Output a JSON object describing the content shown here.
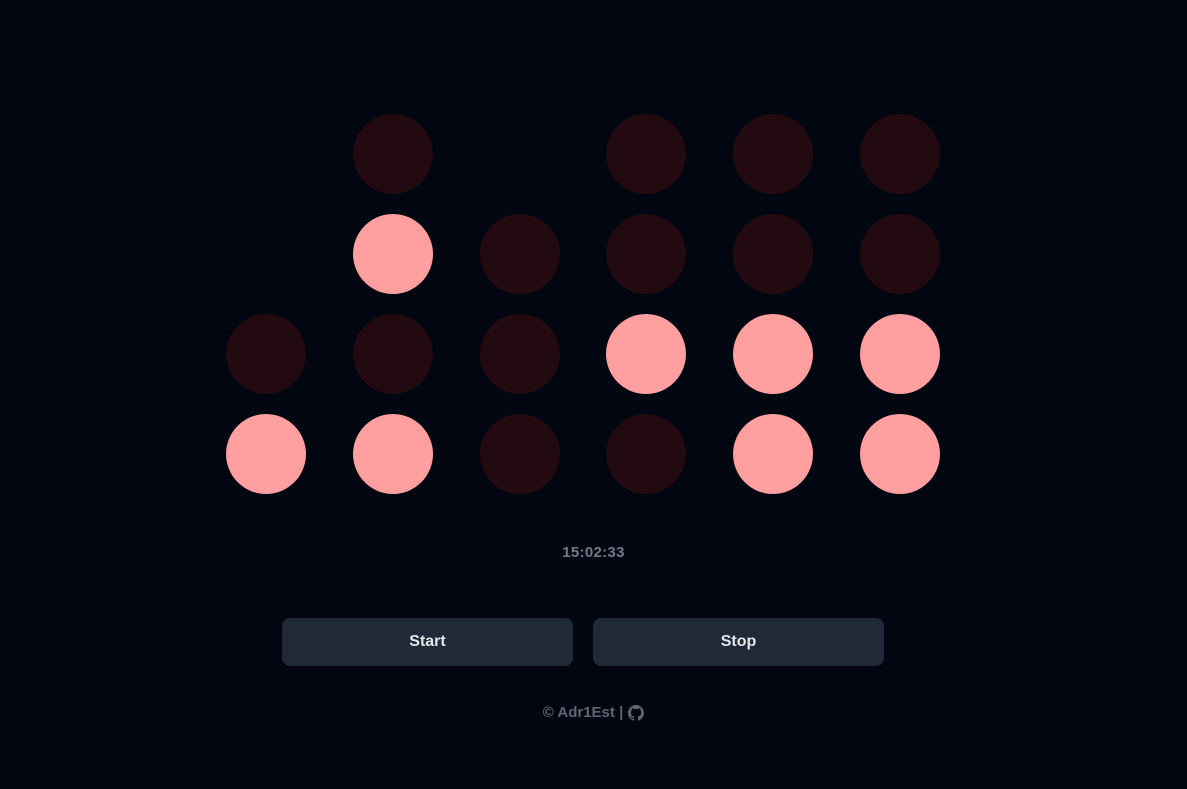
{
  "clock": {
    "time_text": "15:02:33",
    "colors": {
      "on": "#ff9f9f",
      "off": "#230a10",
      "background": "#020611"
    },
    "columns": [
      {
        "digit": 1,
        "bits": [
          null,
          null,
          0,
          1
        ]
      },
      {
        "digit": 5,
        "bits": [
          0,
          1,
          0,
          1
        ]
      },
      {
        "digit": 0,
        "bits": [
          null,
          0,
          0,
          0
        ]
      },
      {
        "digit": 2,
        "bits": [
          0,
          0,
          1,
          0
        ]
      },
      {
        "digit": 3,
        "bits": [
          0,
          0,
          1,
          1
        ]
      },
      {
        "digit": 3,
        "bits": [
          0,
          0,
          1,
          1
        ]
      }
    ]
  },
  "controls": {
    "start_label": "Start",
    "stop_label": "Stop"
  },
  "footer": {
    "text": "© Adr1Est |",
    "icon": "github-icon"
  }
}
